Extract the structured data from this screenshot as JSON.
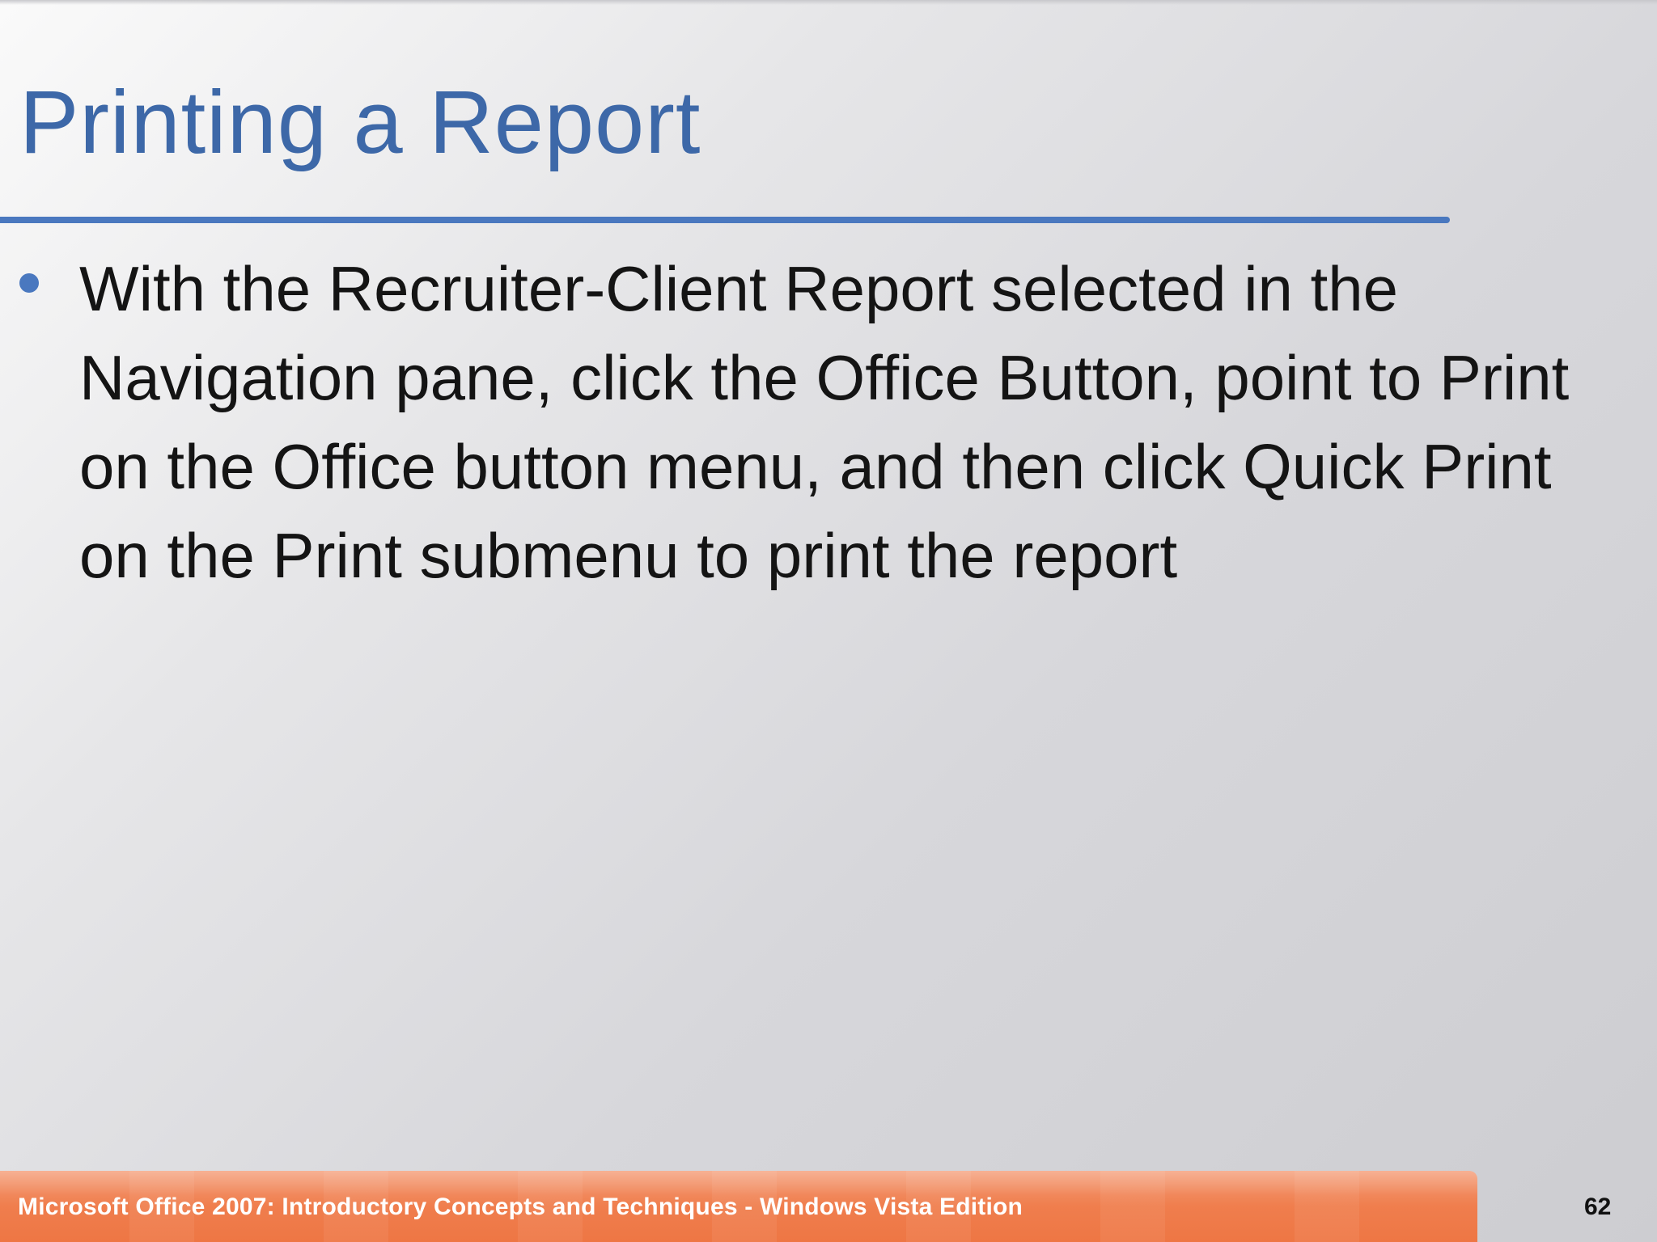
{
  "slide": {
    "title": "Printing a Report",
    "bullets": [
      "With the Recruiter-Client Report selected in the Navigation pane, click the Office Button, point to Print on the Office button menu, and then click Quick Print on the Print submenu to print the report"
    ]
  },
  "footer": {
    "text": "Microsoft Office 2007: Introductory Concepts and Techniques - Windows Vista Edition",
    "page_number": "62"
  },
  "colors": {
    "title": "#3d68a8",
    "accent_rule": "#4a78bf",
    "footer_bar": "#f08050"
  }
}
